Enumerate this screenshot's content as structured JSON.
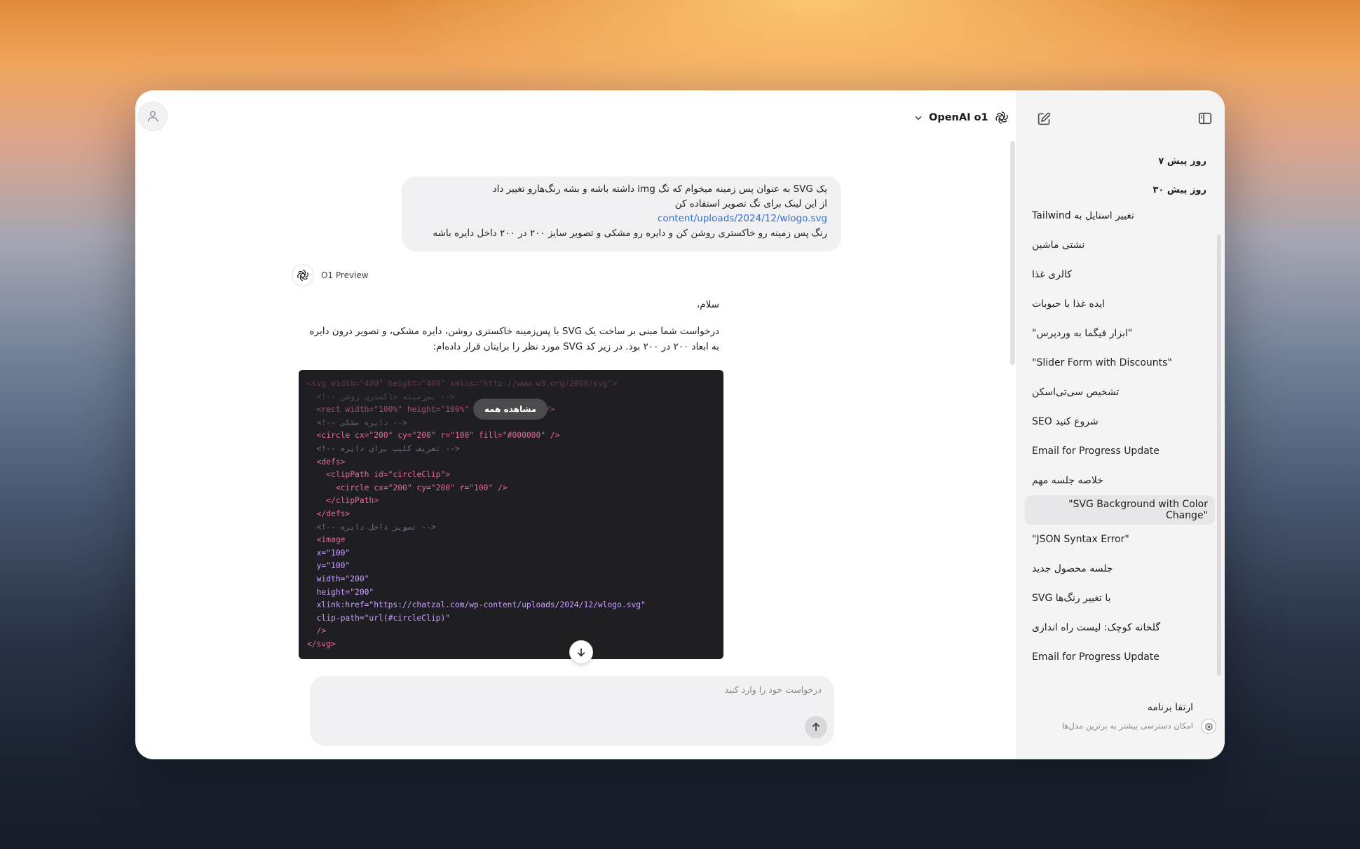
{
  "header": {
    "model_label": "OpenAI o1",
    "model_icon": "openai-logo-icon",
    "chevron_icon": "chevron-down-icon",
    "avatar_icon": "user-icon"
  },
  "sidebar": {
    "toggle_icon": "sidebar-toggle-icon",
    "new_chat_icon": "edit-icon",
    "section_7_days": "۷ روز پیش",
    "section_30_days": "۳۰ روز پیش",
    "items": [
      {
        "label": "تغییر استایل به Tailwind",
        "active": false
      },
      {
        "label": "نشتی ماشین",
        "active": false
      },
      {
        "label": "کالری غذا",
        "active": false
      },
      {
        "label": "ایده غذا با حبوبات",
        "active": false
      },
      {
        "label": "\"ابزار فیگما به وردپرس\"",
        "active": false
      },
      {
        "label": "\"Slider Form with Discounts\"",
        "active": false
      },
      {
        "label": "تشخیص سی‌تی‌اسکن",
        "active": false
      },
      {
        "label": "SEO شروع کنید",
        "active": false
      },
      {
        "label": "Email for Progress Update",
        "active": false
      },
      {
        "label": "خلاصه جلسه مهم",
        "active": false
      },
      {
        "label": "\"SVG Background with Color Change\"",
        "active": true
      },
      {
        "label": "\"JSON Syntax Error\"",
        "active": false
      },
      {
        "label": "جلسه محصول جدید",
        "active": false
      },
      {
        "label": "SVG با تغییر رنگ‌ها",
        "active": false
      },
      {
        "label": "گلخانه کوچک: لیست راه اندازی",
        "active": false
      },
      {
        "label": "Email for Progress Update",
        "active": false
      }
    ],
    "upgrade_title": "ارتقا برنامه",
    "upgrade_subtitle": "امکان دسترسی بیشتر به برترین مدل‌ها",
    "upgrade_icon": "upgrade-icon"
  },
  "conversation": {
    "user_message": {
      "line1": "یک SVG به عنوان پس زمینه میخوام که تگ img داشته باشه و بشه رنگ‌هارو تغییر داد",
      "line2": "از این لینک برای تگ تصویر استفاده کن",
      "link": "content/uploads/2024/12/wlogo.svg",
      "line3": "رنگ پس زمینه رو خاکستری روشن کن و دایره رو مشکی و تصویر سایز ۲۰۰ در ۲۰۰ داخل دایره باشه"
    },
    "assistant": {
      "name": "O1 Preview",
      "greeting": "سلام،",
      "paragraph": "درخواست شما مبنی بر ساخت یک SVG با پس‌زمینه خاکستری روشن، دایره مشکی، و تصویر درون دایره به ابعاد ۲۰۰ در ۲۰۰ بود. در زیر کد SVG مورد نظر را برایتان قرار داده‌ام:",
      "show_all": "مشاهده همه",
      "code": [
        {
          "t": "tag",
          "s": "<svg width=\"400\" height=\"400\" xmlns=\"http://www.w3.org/2000/svg\">",
          "i": ""
        },
        {
          "t": "com",
          "s": "<!-- پس‌زمینه خاکستری روشن -->",
          "i": "  "
        },
        {
          "t": "tag",
          "s": "<rect width=\"100%\" height=\"100%\" fill=\"#D3D3D3\" />",
          "i": "  "
        },
        {
          "t": "com",
          "s": "<!-- دایره مشکی -->",
          "i": "  "
        },
        {
          "t": "tag",
          "s": "<circle cx=\"200\" cy=\"200\" r=\"100\" fill=\"#000000\" />",
          "i": "  "
        },
        {
          "t": "com",
          "s": "<!-- تعریف کلیپ برای دایره -->",
          "i": "  "
        },
        {
          "t": "tag",
          "s": "<defs>",
          "i": "  "
        },
        {
          "t": "tag",
          "s": "<clipPath id=\"circleClip\">",
          "i": "    "
        },
        {
          "t": "tag",
          "s": "<circle cx=\"200\" cy=\"200\" r=\"100\" />",
          "i": "      "
        },
        {
          "t": "tag",
          "s": "</clipPath>",
          "i": "    "
        },
        {
          "t": "tag",
          "s": "</defs>",
          "i": "  "
        },
        {
          "t": "com",
          "s": "<!-- تصویر داخل دایره -->",
          "i": "  "
        },
        {
          "t": "tag",
          "s": "<image",
          "i": "  "
        },
        {
          "t": "attr",
          "s": "x=\"100\"",
          "i": "  "
        },
        {
          "t": "attr",
          "s": "y=\"100\"",
          "i": "  "
        },
        {
          "t": "attr",
          "s": "width=\"200\"",
          "i": "  "
        },
        {
          "t": "attr",
          "s": "height=\"200\"",
          "i": "  "
        },
        {
          "t": "attr",
          "s": "xlink:href=\"https://chatzal.com/wp-content/uploads/2024/12/wlogo.svg\"",
          "i": "  "
        },
        {
          "t": "attr",
          "s": "clip-path=\"url(#circleClip)\"",
          "i": "  "
        },
        {
          "t": "tag",
          "s": "/>",
          "i": "  "
        },
        {
          "t": "tag",
          "s": "</svg>",
          "i": ""
        }
      ]
    }
  },
  "composer": {
    "placeholder": "درخواست خود را وارد کنید",
    "value": "",
    "send_icon": "arrow-up-icon",
    "scroll_icon": "arrow-down-icon"
  },
  "colors": {
    "accent_link": "#2f6fd8",
    "code_bg": "#1f1f23",
    "sidebar_bg": "#f4f4f5",
    "active_item_bg": "#e6e6e8"
  }
}
